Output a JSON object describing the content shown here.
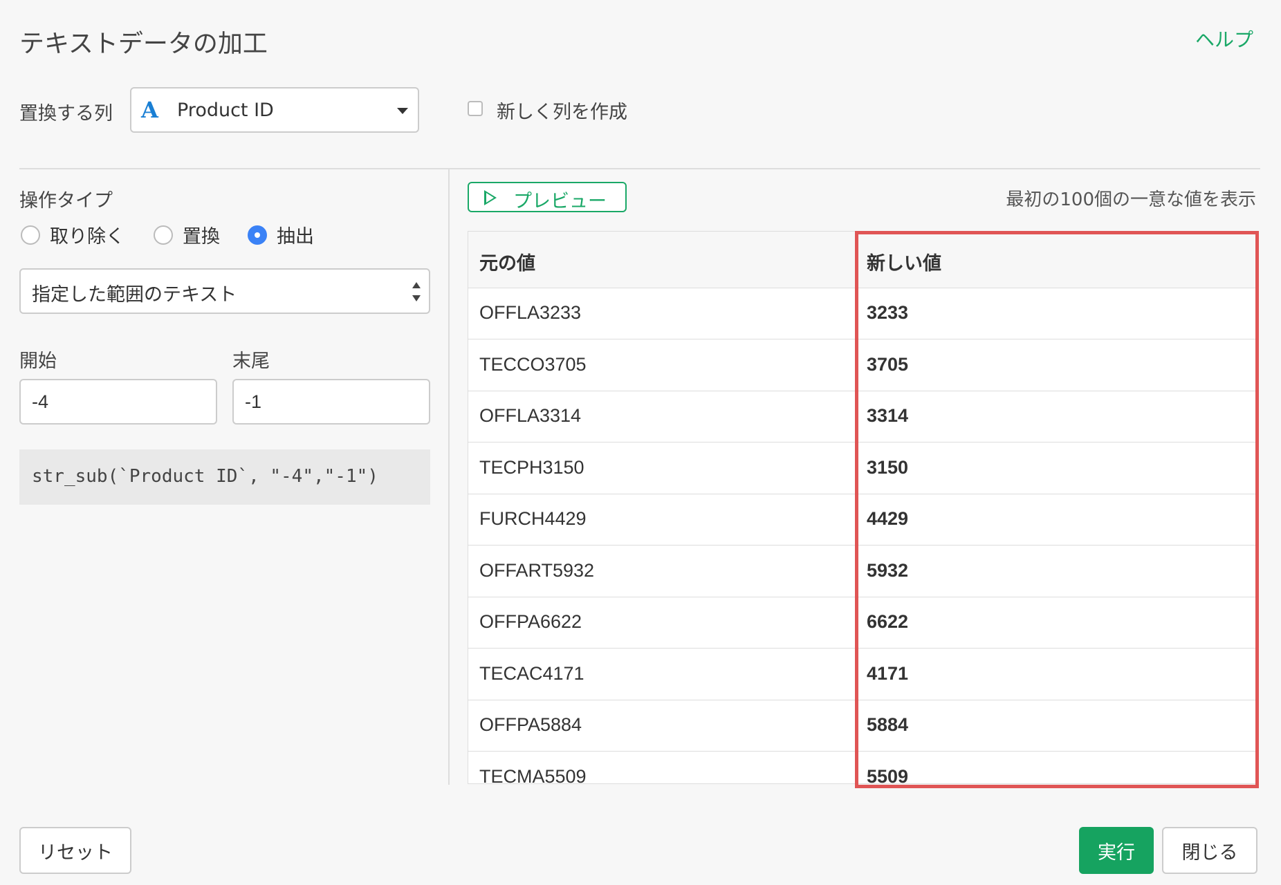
{
  "header": {
    "title": "テキストデータの加工",
    "help": "ヘルプ"
  },
  "column": {
    "label": "置換する列",
    "type_icon": "A",
    "name": "Product ID"
  },
  "new_column": {
    "label": "新しく列を作成",
    "checked": false
  },
  "operation": {
    "label": "操作タイプ",
    "options": [
      {
        "label": "取り除く",
        "selected": false
      },
      {
        "label": "置換",
        "selected": false
      },
      {
        "label": "抽出",
        "selected": true
      }
    ]
  },
  "range_select": {
    "value": "指定した範囲のテキスト"
  },
  "range": {
    "start_label": "開始",
    "start_value": "-4",
    "end_label": "末尾",
    "end_value": "-1"
  },
  "code": "str_sub(`Product ID`, \"-4\",\"-1\")",
  "preview": {
    "button": "プレビュー",
    "note": "最初の100個の一意な値を表示"
  },
  "table": {
    "headers": [
      "元の値",
      "新しい値"
    ],
    "rows": [
      [
        "OFFLA3233",
        "3233"
      ],
      [
        "TECCO3705",
        "3705"
      ],
      [
        "OFFLA3314",
        "3314"
      ],
      [
        "TECPH3150",
        "3150"
      ],
      [
        "FURCH4429",
        "4429"
      ],
      [
        "OFFART5932",
        "5932"
      ],
      [
        "OFFPA6622",
        "6622"
      ],
      [
        "TECAC4171",
        "4171"
      ],
      [
        "OFFPA5884",
        "5884"
      ],
      [
        "TECMA5509",
        "5509"
      ]
    ]
  },
  "footer": {
    "reset": "リセット",
    "run": "実行",
    "close": "閉じる"
  },
  "colors": {
    "accent": "#1aa867",
    "run_button": "#16a360",
    "highlight": "#e05555",
    "radio_selected": "#3b82f6"
  }
}
